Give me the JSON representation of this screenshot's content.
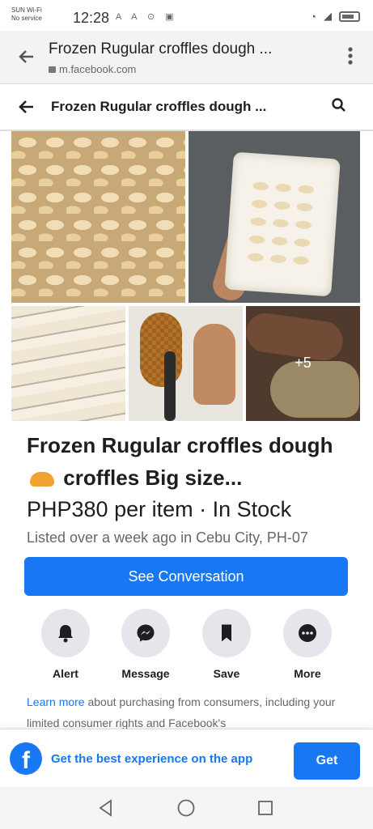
{
  "statusbar": {
    "carrier_line1": "SUN Wi-Fi",
    "carrier_line2": "No service",
    "time": "12:28",
    "glyphs": "A A ⊙ ▣"
  },
  "browser": {
    "title": "Frozen Rugular croffles dough ...",
    "url": "m.facebook.com"
  },
  "header": {
    "title": "Frozen Rugular croffles dough ..."
  },
  "gallery": {
    "more_count": "+5"
  },
  "listing": {
    "title_part1": "Frozen Rugular croffles dough",
    "title_part2": "croffles Big size...",
    "price": "PHP380 per item · In Stock",
    "location": "Listed over a week ago in Cebu City, PH-07",
    "see_conversation": "See Conversation"
  },
  "actions": [
    {
      "label": "Alert",
      "icon": "bell-icon"
    },
    {
      "label": "Message",
      "icon": "messenger-icon"
    },
    {
      "label": "Save",
      "icon": "bookmark-icon"
    },
    {
      "label": "More",
      "icon": "more-icon"
    }
  ],
  "learn_more": {
    "link": "Learn more",
    "text": " about purchasing from consumers, including your limited consumer rights and Facebook's"
  },
  "app_banner": {
    "text": "Get the best experience on the app",
    "button": "Get"
  },
  "colors": {
    "accent": "#1877f2",
    "text": "#1c1e21",
    "secondary": "#65676b"
  }
}
